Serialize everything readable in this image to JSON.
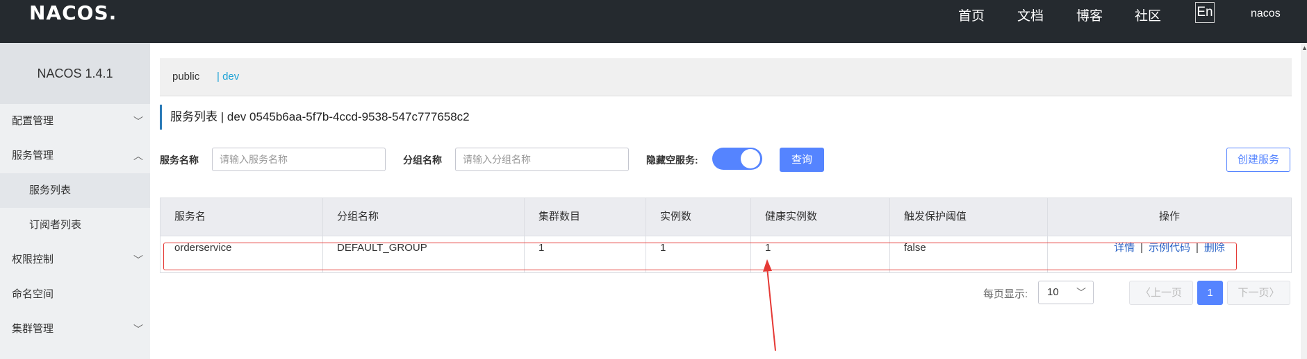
{
  "header": {
    "logo": "NACOS.",
    "nav": [
      "首页",
      "文档",
      "博客",
      "社区"
    ],
    "lang": "En",
    "user": "nacos"
  },
  "sidebar": {
    "title": "NACOS 1.4.1",
    "items": [
      {
        "label": "配置管理",
        "icon": "chevron-down-icon"
      },
      {
        "label": "服务管理",
        "icon": "chevron-up-icon"
      },
      {
        "label": "服务列表"
      },
      {
        "label": "订阅者列表"
      },
      {
        "label": "权限控制",
        "icon": "chevron-down-icon"
      },
      {
        "label": "命名空间"
      },
      {
        "label": "集群管理",
        "icon": "chevron-down-icon"
      }
    ]
  },
  "namespaces": {
    "items": [
      "public",
      "| dev"
    ],
    "active_color": "#1fa3d6"
  },
  "page": {
    "title": "服务列表  |  dev  0545b6aa-5f7b-4ccd-9538-547c777658c2"
  },
  "filters": {
    "service_label": "服务名称",
    "service_placeholder": "请输入服务名称",
    "group_label": "分组名称",
    "group_placeholder": "请输入分组名称",
    "hide_empty_label": "隐藏空服务:",
    "hide_empty_on": true,
    "query_button": "查询",
    "create_button": "创建服务"
  },
  "table": {
    "headers": [
      "服务名",
      "分组名称",
      "集群数目",
      "实例数",
      "健康实例数",
      "触发保护阈值",
      "操作"
    ],
    "rows": [
      {
        "name": "orderservice",
        "group": "DEFAULT_GROUP",
        "clusters": "1",
        "instances": "1",
        "healthy": "1",
        "threshold": "false",
        "ops": [
          "详情",
          "示例代码",
          "删除"
        ]
      }
    ]
  },
  "pagination": {
    "label": "每页显示:",
    "page_size": "10",
    "prev": "上一页",
    "current": "1",
    "next": "下一页"
  },
  "colors": {
    "primary": "#5584ff",
    "header_bg": "#252a2f",
    "annotation": "#e53935"
  }
}
